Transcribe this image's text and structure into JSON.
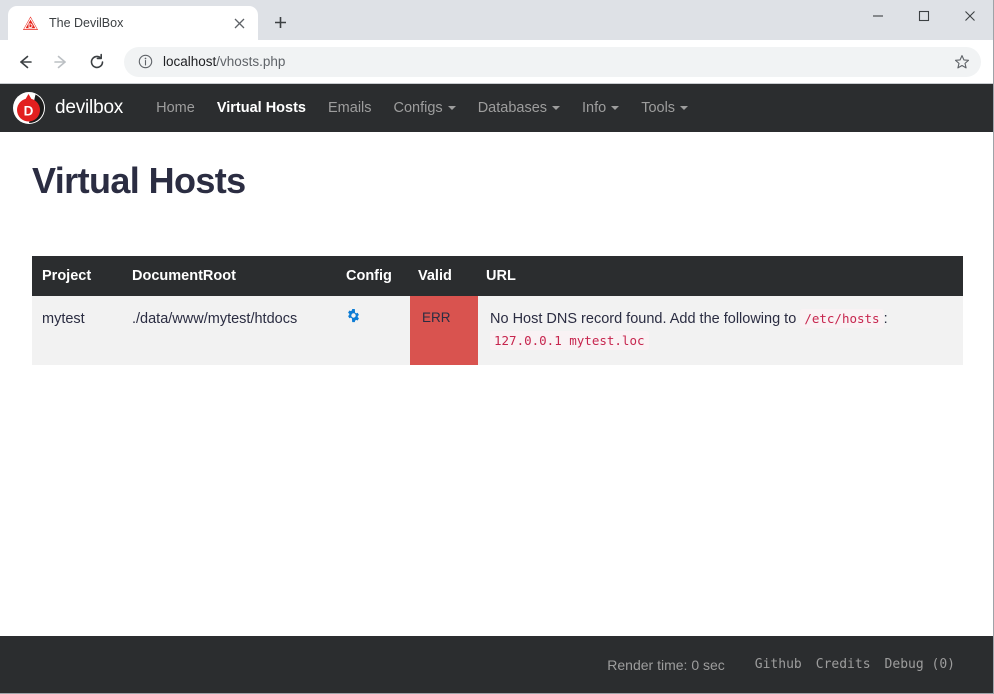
{
  "browser": {
    "tab": {
      "title": "The DevilBox",
      "favicon": "devilbox-triangle-icon",
      "close_label": "×"
    },
    "newtab_label": "+",
    "window_controls": {
      "minimize": "—",
      "maximize": "☐",
      "close": "✕"
    },
    "nav": {
      "back": "←",
      "forward": "→",
      "reload": "⟳"
    },
    "omnibox": {
      "info_icon": "info-circle-icon",
      "url_host": "localhost",
      "url_path": "/vhosts.php",
      "star_icon": "bookmark-star-icon"
    }
  },
  "site": {
    "brand": {
      "label": "devilbox",
      "logo": "devilbox-drop-icon"
    },
    "nav_items": [
      {
        "label": "Home",
        "active": false,
        "has_caret": false
      },
      {
        "label": "Virtual Hosts",
        "active": true,
        "has_caret": false
      },
      {
        "label": "Emails",
        "active": false,
        "has_caret": false
      },
      {
        "label": "Configs",
        "active": false,
        "has_caret": true
      },
      {
        "label": "Databases",
        "active": false,
        "has_caret": true
      },
      {
        "label": "Info",
        "active": false,
        "has_caret": true
      },
      {
        "label": "Tools",
        "active": false,
        "has_caret": true
      }
    ]
  },
  "page": {
    "title": "Virtual Hosts",
    "table": {
      "headers": [
        "Project",
        "DocumentRoot",
        "Config",
        "Valid",
        "URL"
      ],
      "rows": [
        {
          "project": "mytest",
          "documentroot": "./data/www/mytest/htdocs",
          "config_icon": "gear-icon",
          "valid": "ERR",
          "url_message_prefix": "No Host DNS record found. Add the following to",
          "url_code_file": "/etc/hosts",
          "url_message_colon": ":",
          "url_code_entry": "127.0.0.1 mytest.loc"
        }
      ]
    }
  },
  "footer": {
    "render_time": "Render time: 0 sec",
    "links": [
      "Github",
      "Credits",
      "Debug (0)"
    ]
  },
  "colors": {
    "navbar_bg": "#2b2d2f",
    "error_red": "#d9534f",
    "brand_red": "#e21f1f",
    "gear_blue": "#0c7cd5",
    "code_red": "#c7254e",
    "title_dark": "#2b2d42"
  }
}
